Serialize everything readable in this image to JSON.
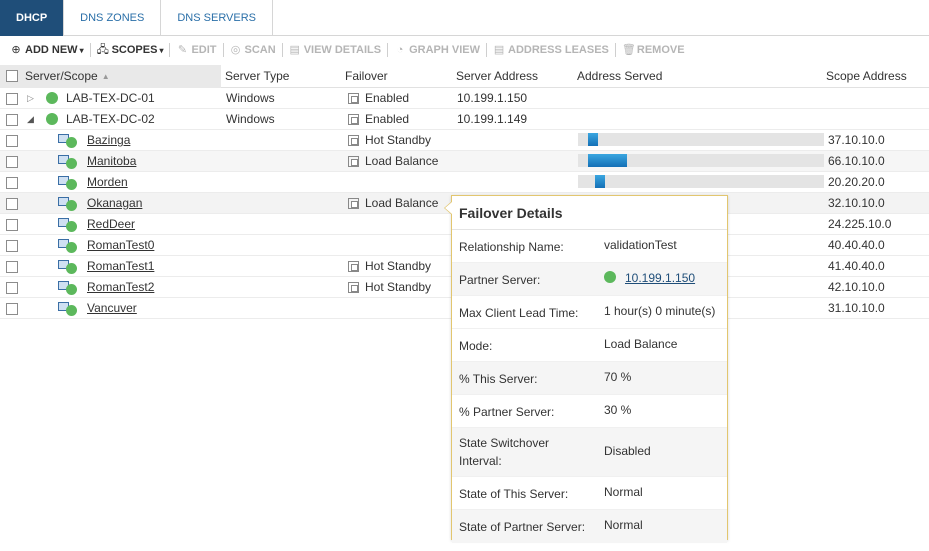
{
  "tabs": [
    {
      "label": "DHCP",
      "active": true
    },
    {
      "label": "DNS ZONES",
      "active": false
    },
    {
      "label": "DNS SERVERS",
      "active": false
    }
  ],
  "toolbar": {
    "add_new": "ADD NEW",
    "scopes": "SCOPES",
    "edit": "EDIT",
    "scan": "SCAN",
    "view_details": "VIEW DETAILS",
    "graph_view": "GRAPH VIEW",
    "address_leases": "ADDRESS LEASES",
    "remove": "REMOVE"
  },
  "columns": {
    "server_scope": "Server/Scope",
    "server_type": "Server Type",
    "failover": "Failover",
    "server_address": "Server Address",
    "address_served": "Address Served",
    "scope_address": "Scope Address"
  },
  "servers": [
    {
      "name": "LAB-TEX-DC-01",
      "type": "Windows",
      "failover": "Enabled",
      "address": "10.199.1.150",
      "expanded": false
    },
    {
      "name": "LAB-TEX-DC-02",
      "type": "Windows",
      "failover": "Enabled",
      "address": "10.199.1.149",
      "expanded": true
    }
  ],
  "scopes": [
    {
      "name": "Bazinga",
      "failover": "Hot Standby",
      "scope_address": "37.10.10.0",
      "served_start": 0.04,
      "served_width": 0.04
    },
    {
      "name": "Manitoba",
      "failover": "Load Balance",
      "scope_address": "66.10.10.0",
      "served_start": 0.04,
      "served_width": 0.16
    },
    {
      "name": "Morden",
      "failover": "",
      "scope_address": "20.20.20.0",
      "served_start": 0.07,
      "served_width": 0.04
    },
    {
      "name": "Okanagan",
      "failover": "Load Balance",
      "scope_address": "32.10.10.0",
      "served_start": 0,
      "served_width": 0
    },
    {
      "name": "RedDeer",
      "failover": "",
      "scope_address": "24.225.10.0",
      "served_start": 0,
      "served_width": 0
    },
    {
      "name": "RomanTest0",
      "failover": "",
      "scope_address": "40.40.40.0",
      "served_start": 0,
      "served_width": 0
    },
    {
      "name": "RomanTest1",
      "failover": "Hot Standby",
      "scope_address": "41.40.40.0",
      "served_start": 0,
      "served_width": 0
    },
    {
      "name": "RomanTest2",
      "failover": "Hot Standby",
      "scope_address": "42.10.10.0",
      "served_start": 0,
      "served_width": 0
    },
    {
      "name": "Vancuver",
      "failover": "",
      "scope_address": "31.10.10.0",
      "served_start": 0,
      "served_width": 0
    }
  ],
  "popup": {
    "title": "Failover Details",
    "rows": [
      {
        "label": "Relationship Name:",
        "value": "validationTest"
      },
      {
        "label": "Partner Server:",
        "value": "10.199.1.150"
      },
      {
        "label": "Max Client Lead Time:",
        "value": "1 hour(s) 0 minute(s)"
      },
      {
        "label": "Mode:",
        "value": "Load Balance"
      },
      {
        "label": "% This Server:",
        "value": "70 %"
      },
      {
        "label": "% Partner Server:",
        "value": "30 %"
      },
      {
        "label": "State Switchover Interval:",
        "value": "Disabled"
      },
      {
        "label": "State of This Server:",
        "value": "Normal"
      },
      {
        "label": "State of Partner Server:",
        "value": "Normal"
      }
    ]
  },
  "colors": {
    "accent": "#1f4e79",
    "status_ok": "#5cb85c",
    "bar": "#1a8ad4"
  }
}
